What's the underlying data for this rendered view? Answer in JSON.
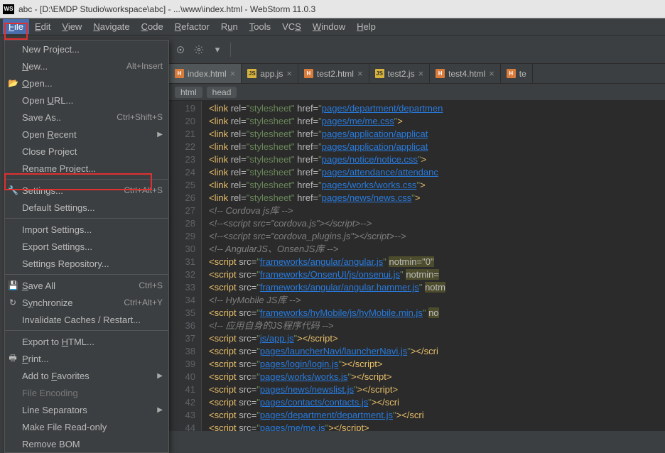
{
  "title": "abc - [D:\\EMDP Studio\\workspace\\abc] - ...\\www\\index.html - WebStorm 11.0.3",
  "logo": "WS",
  "menubar": [
    {
      "label": "File",
      "mn": "F",
      "active": true
    },
    {
      "label": "Edit",
      "mn": "E"
    },
    {
      "label": "View",
      "mn": "V"
    },
    {
      "label": "Navigate",
      "mn": "N"
    },
    {
      "label": "Code",
      "mn": "C"
    },
    {
      "label": "Refactor",
      "mn": "R"
    },
    {
      "label": "Run",
      "mn": "u"
    },
    {
      "label": "Tools",
      "mn": "T"
    },
    {
      "label": "VCS",
      "mn": "S"
    },
    {
      "label": "Window",
      "mn": "W"
    },
    {
      "label": "Help",
      "mn": "H"
    }
  ],
  "dropdown": [
    {
      "label": "New Project...",
      "mn": ""
    },
    {
      "label": "New...",
      "mn": "N",
      "shortcut": "Alt+Insert"
    },
    {
      "label": "Open...",
      "mn": "O",
      "icon": "folder"
    },
    {
      "label": "Open URL...",
      "mn": "U"
    },
    {
      "label": "Save As..",
      "mn": "",
      "shortcut": "Ctrl+Shift+S"
    },
    {
      "label": "Open Recent",
      "mn": "R",
      "submenu": true
    },
    {
      "label": "Close Project",
      "mn": "J"
    },
    {
      "label": "Rename Project...",
      "mn": ""
    },
    {
      "sep": true
    },
    {
      "label": "Settings...",
      "mn": "T",
      "shortcut": "Ctrl+Alt+S",
      "icon": "wrench"
    },
    {
      "label": "Default Settings...",
      "mn": ""
    },
    {
      "sep": true
    },
    {
      "label": "Import Settings...",
      "mn": ""
    },
    {
      "label": "Export Settings...",
      "mn": ""
    },
    {
      "label": "Settings Repository...",
      "mn": ""
    },
    {
      "sep": true
    },
    {
      "label": "Save All",
      "mn": "S",
      "shortcut": "Ctrl+S",
      "icon": "disk"
    },
    {
      "label": "Synchronize",
      "mn": "y",
      "shortcut": "Ctrl+Alt+Y",
      "icon": "sync"
    },
    {
      "label": "Invalidate Caches / Restart...",
      "mn": ""
    },
    {
      "sep": true
    },
    {
      "label": "Export to HTML...",
      "mn": "H"
    },
    {
      "label": "Print...",
      "mn": "P",
      "icon": "print"
    },
    {
      "label": "Add to Favorites",
      "mn": "F",
      "submenu": true
    },
    {
      "label": "File Encoding",
      "disabled": true
    },
    {
      "label": "Line Separators",
      "mn": "",
      "submenu": true
    },
    {
      "label": "Make File Read-only",
      "mn": ""
    },
    {
      "label": "Remove BOM",
      "mn": ""
    }
  ],
  "tabs": [
    {
      "name": "index.html",
      "type": "html",
      "active": true
    },
    {
      "name": "app.js",
      "type": "js"
    },
    {
      "name": "test2.html",
      "type": "html"
    },
    {
      "name": "test2.js",
      "type": "js"
    },
    {
      "name": "test4.html",
      "type": "html"
    },
    {
      "name": "te",
      "type": "html",
      "noclose": true
    }
  ],
  "breadcrumb": [
    "html",
    "head"
  ],
  "gutter_start": 19,
  "gutter_end": 44,
  "code_lines": [
    {
      "t": "link",
      "rel": "stylesheet",
      "href": "pages/department/departmen",
      "trunc": true
    },
    {
      "t": "link",
      "rel": "stylesheet",
      "href": "pages/me/me.css"
    },
    {
      "t": "link",
      "rel": "stylesheet",
      "href": "pages/application/applicat",
      "trunc": true
    },
    {
      "t": "link",
      "rel": "stylesheet",
      "href": "pages/application/applicat",
      "trunc": true
    },
    {
      "t": "link",
      "rel": "stylesheet",
      "href": "pages/notice/notice.css"
    },
    {
      "t": "link",
      "rel": "stylesheet",
      "href": "pages/attendance/attendanc",
      "trunc": true
    },
    {
      "t": "link",
      "rel": "stylesheet",
      "href": "pages/works/works.css"
    },
    {
      "t": "link",
      "rel": "stylesheet",
      "href": "pages/news/news.css"
    },
    {
      "t": "cmt",
      "text": "<!-- Cordova js库 -->"
    },
    {
      "t": "cmt",
      "text": "<!--<script src=\"cordova.js\"></script>-->"
    },
    {
      "t": "cmt",
      "text": "<!--<script src=\"cordova_plugins.js\"></script>-->"
    },
    {
      "t": "cmt",
      "text": "<!-- AngularJS、OnsenJS库 -->"
    },
    {
      "t": "script",
      "src": "frameworks/angular/angular.js",
      "extra": "notmin=\"0\"",
      "trunc": true
    },
    {
      "t": "script",
      "src": "frameworks/OnsenUI/js/onsenui.js",
      "extra": "notmin=",
      "trunc": true
    },
    {
      "t": "script",
      "src": "frameworks/angular/angular.hammer.js",
      "extra": "notm",
      "trunc": true
    },
    {
      "t": "cmt",
      "text": "<!-- HyMobile JS库 -->"
    },
    {
      "t": "script",
      "src": "frameworks/hyMobile/js/hyMobile.min.js",
      "extra": "no",
      "trunc": true
    },
    {
      "t": "cmt",
      "text": "<!-- 应用自身的JS程序代码 -->"
    },
    {
      "t": "script",
      "src": "js/app.js"
    },
    {
      "t": "script",
      "src": "pages/launcherNavi/launcherNavi.js",
      "closetrunc": true
    },
    {
      "t": "script",
      "src": "pages/login/login.js"
    },
    {
      "t": "script",
      "src": "pages/works/works.js"
    },
    {
      "t": "script",
      "src": "pages/news/newslist.js"
    },
    {
      "t": "script",
      "src": "pages/contacts/contacts.js",
      "closetrunc": true
    },
    {
      "t": "script",
      "src": "pages/department/department.js",
      "closetrunc": true
    },
    {
      "t": "script",
      "src": "pages/me/me.js"
    }
  ]
}
